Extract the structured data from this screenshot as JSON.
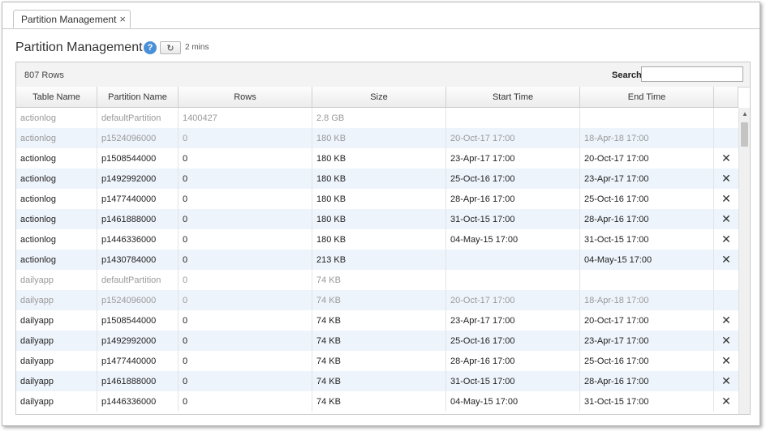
{
  "tab": {
    "label": "Partition Management",
    "close": "×"
  },
  "page": {
    "title": "Partition Management",
    "help": "?",
    "refresh_icon": "↻",
    "refresh_interval": "2 mins"
  },
  "toolbar": {
    "row_count": "807 Rows",
    "search_label": "Search",
    "search_value": ""
  },
  "columns": [
    "Table Name",
    "Partition Name",
    "Rows",
    "Size",
    "Start Time",
    "End Time",
    ""
  ],
  "rows": [
    {
      "table": "actionlog",
      "partition": "defaultPartition",
      "rows": "1400427",
      "size": "2.8 GB",
      "start": "",
      "end": "",
      "deletable": false,
      "muted": true
    },
    {
      "table": "actionlog",
      "partition": "p1524096000",
      "rows": "0",
      "size": "180 KB",
      "start": "20-Oct-17 17:00",
      "end": "18-Apr-18 17:00",
      "deletable": false,
      "muted": true
    },
    {
      "table": "actionlog",
      "partition": "p1508544000",
      "rows": "0",
      "size": "180 KB",
      "start": "23-Apr-17 17:00",
      "end": "20-Oct-17 17:00",
      "deletable": true,
      "muted": false
    },
    {
      "table": "actionlog",
      "partition": "p1492992000",
      "rows": "0",
      "size": "180 KB",
      "start": "25-Oct-16 17:00",
      "end": "23-Apr-17 17:00",
      "deletable": true,
      "muted": false
    },
    {
      "table": "actionlog",
      "partition": "p1477440000",
      "rows": "0",
      "size": "180 KB",
      "start": "28-Apr-16 17:00",
      "end": "25-Oct-16 17:00",
      "deletable": true,
      "muted": false
    },
    {
      "table": "actionlog",
      "partition": "p1461888000",
      "rows": "0",
      "size": "180 KB",
      "start": "31-Oct-15 17:00",
      "end": "28-Apr-16 17:00",
      "deletable": true,
      "muted": false
    },
    {
      "table": "actionlog",
      "partition": "p1446336000",
      "rows": "0",
      "size": "180 KB",
      "start": "04-May-15 17:00",
      "end": "31-Oct-15 17:00",
      "deletable": true,
      "muted": false
    },
    {
      "table": "actionlog",
      "partition": "p1430784000",
      "rows": "0",
      "size": "213 KB",
      "start": "",
      "end": "04-May-15 17:00",
      "deletable": true,
      "muted": false
    },
    {
      "table": "dailyapp",
      "partition": "defaultPartition",
      "rows": "0",
      "size": "74 KB",
      "start": "",
      "end": "",
      "deletable": false,
      "muted": true
    },
    {
      "table": "dailyapp",
      "partition": "p1524096000",
      "rows": "0",
      "size": "74 KB",
      "start": "20-Oct-17 17:00",
      "end": "18-Apr-18 17:00",
      "deletable": false,
      "muted": true
    },
    {
      "table": "dailyapp",
      "partition": "p1508544000",
      "rows": "0",
      "size": "74 KB",
      "start": "23-Apr-17 17:00",
      "end": "20-Oct-17 17:00",
      "deletable": true,
      "muted": false
    },
    {
      "table": "dailyapp",
      "partition": "p1492992000",
      "rows": "0",
      "size": "74 KB",
      "start": "25-Oct-16 17:00",
      "end": "23-Apr-17 17:00",
      "deletable": true,
      "muted": false
    },
    {
      "table": "dailyapp",
      "partition": "p1477440000",
      "rows": "0",
      "size": "74 KB",
      "start": "28-Apr-16 17:00",
      "end": "25-Oct-16 17:00",
      "deletable": true,
      "muted": false
    },
    {
      "table": "dailyapp",
      "partition": "p1461888000",
      "rows": "0",
      "size": "74 KB",
      "start": "31-Oct-15 17:00",
      "end": "28-Apr-16 17:00",
      "deletable": true,
      "muted": false
    },
    {
      "table": "dailyapp",
      "partition": "p1446336000",
      "rows": "0",
      "size": "74 KB",
      "start": "04-May-15 17:00",
      "end": "31-Oct-15 17:00",
      "deletable": true,
      "muted": false
    }
  ],
  "delete_glyph": "✕",
  "icons": {
    "help": "help-icon",
    "refresh": "refresh-icon",
    "close": "close-icon",
    "delete": "delete-icon",
    "scroll_up": "scroll-up-arrow-icon"
  },
  "colors": {
    "help_blue": "#4a90d9",
    "alt_row": "#eef4fc",
    "muted_text": "#999999"
  }
}
